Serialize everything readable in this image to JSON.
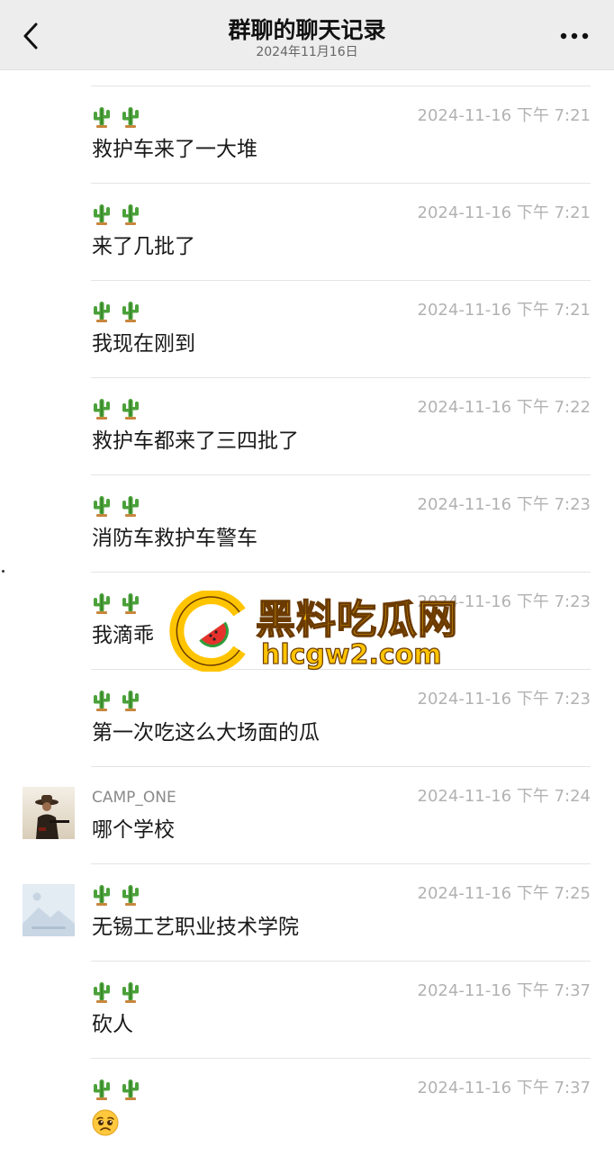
{
  "header": {
    "title": "群聊的聊天记录",
    "subtitle": "2024年11月16日",
    "back_icon": "chevron-left-icon",
    "more_icon": "more-dots-icon"
  },
  "colors": {
    "header_bg": "#ededed",
    "time_text": "#b2b2b2",
    "watermark": "#ffc400"
  },
  "messages": [
    {
      "sender_icon": "cactus-icon",
      "sender": "",
      "time": "2024-11-16 下午 7:21",
      "text": "救护车来了一大堆"
    },
    {
      "sender_icon": "cactus-icon",
      "sender": "",
      "time": "2024-11-16 下午 7:21",
      "text": "来了几批了"
    },
    {
      "sender_icon": "cactus-icon",
      "sender": "",
      "time": "2024-11-16 下午 7:21",
      "text": "我现在刚到"
    },
    {
      "sender_icon": "cactus-icon",
      "sender": "",
      "time": "2024-11-16 下午 7:22",
      "text": "救护车都来了三四批了"
    },
    {
      "sender_icon": "cactus-icon",
      "sender": "",
      "time": "2024-11-16 下午 7:23",
      "text": "消防车救护车警车"
    },
    {
      "sender_icon": "cactus-icon",
      "sender": "",
      "time": "2024-11-16 下午 7:23",
      "text": "我滴乖"
    },
    {
      "sender_icon": "cactus-icon",
      "sender": "",
      "time": "2024-11-16 下午 7:23",
      "text": "第一次吃这么大场面的瓜"
    },
    {
      "sender_icon": "",
      "sender": "CAMP_ONE",
      "time": "2024-11-16 下午 7:24",
      "text": "哪个学校",
      "avatar": "cowboy-avatar"
    },
    {
      "sender_icon": "cactus-icon",
      "sender": "",
      "time": "2024-11-16 下午 7:25",
      "text": "无锡工艺职业技术学院",
      "avatar": "placeholder-image-avatar"
    },
    {
      "sender_icon": "cactus-icon",
      "sender": "",
      "time": "2024-11-16 下午 7:37",
      "text": "砍人"
    },
    {
      "sender_icon": "cactus-icon",
      "sender": "",
      "time": "2024-11-16 下午 7:37",
      "text": "",
      "emoji": "pleading-face-icon"
    }
  ],
  "watermark": {
    "name": "黑料吃瓜网",
    "url": "hlcgw2.com",
    "logo_icon": "watermelon-logo-icon"
  }
}
